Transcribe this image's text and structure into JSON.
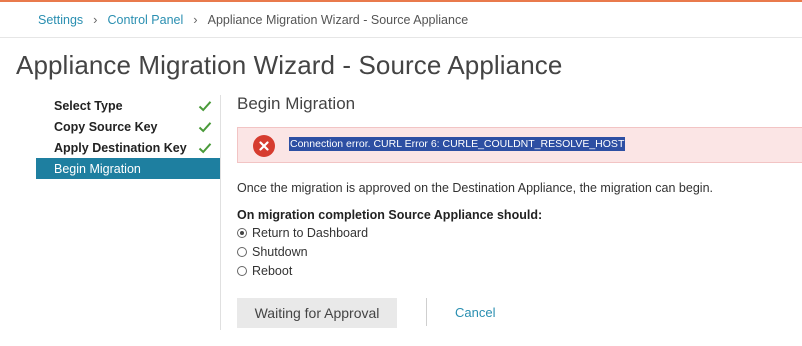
{
  "breadcrumb": {
    "items": [
      "Settings",
      "Control Panel",
      "Appliance Migration Wizard - Source Appliance"
    ],
    "separator": "›"
  },
  "page_title": "Appliance Migration Wizard - Source Appliance",
  "steps": [
    {
      "label": "Select Type",
      "state": "complete"
    },
    {
      "label": "Copy Source Key",
      "state": "complete"
    },
    {
      "label": "Apply Destination Key",
      "state": "complete"
    },
    {
      "label": "Begin Migration",
      "state": "active"
    }
  ],
  "section_title": "Begin Migration",
  "error": {
    "icon": "error-x-icon",
    "message": "Connection error. CURL Error 6: CURLE_COULDNT_RESOLVE_HOST"
  },
  "info_text": "Once the migration is approved on the Destination Appliance, the migration can begin.",
  "completion": {
    "question": "On migration completion Source Appliance should:",
    "options": [
      {
        "label": "Return to Dashboard",
        "selected": true
      },
      {
        "label": "Shutdown",
        "selected": false
      },
      {
        "label": "Reboot",
        "selected": false
      }
    ]
  },
  "actions": {
    "waiting_label": "Waiting for Approval",
    "cancel_label": "Cancel"
  },
  "colors": {
    "accent": "#1e7fa0",
    "link": "#2a8fb1",
    "check": "#4a9a3a",
    "error_bg": "#fbe5e5",
    "error_icon": "#d63c2f",
    "selection": "#2d4fa3"
  }
}
